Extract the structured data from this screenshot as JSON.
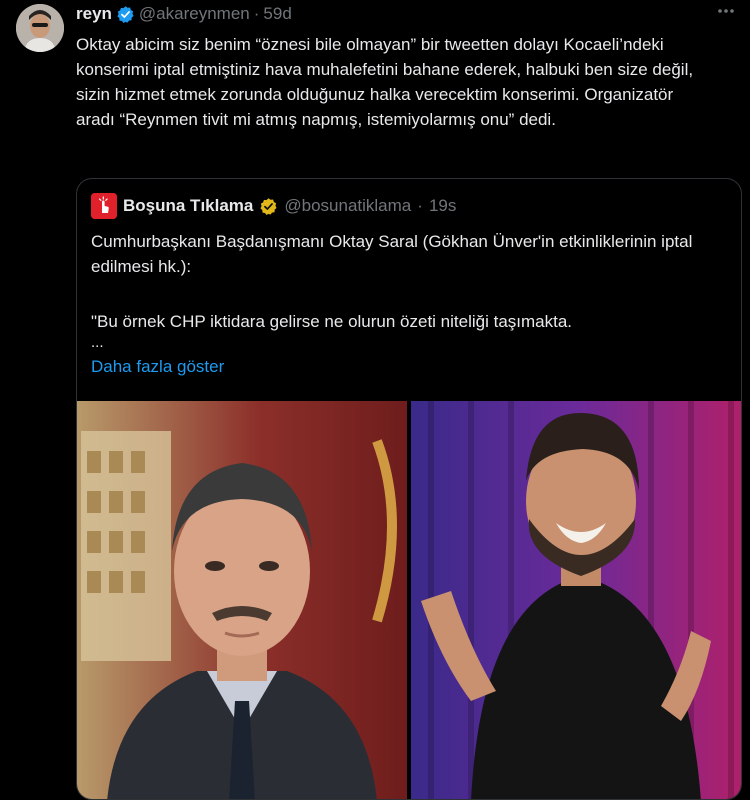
{
  "tweet": {
    "display_name": "reyn",
    "handle": "@akareynmen",
    "separator": "·",
    "time": "59d",
    "more_icon": "ellipsis-icon",
    "text": "Oktay abicim siz benim “öznesi bile olmayan” bir tweetten dolayı Kocaeli’ndeki konserimi iptal etmiştiniz hava muhalefetini bahane ederek, halbuki ben size değil, sizin hizmet etmek zorunda olduğunuz halka verecektim konserimi. Organizatör aradı “Reynmen tivit mi atmış napmış, istemiyolarmış onu” dedi."
  },
  "quoted": {
    "display_name": "Boşuna Tıklama",
    "handle": "@bosunatiklama",
    "separator": "·",
    "time": "19s",
    "paragraph1": "Cumhurbaşkanı Başdanışmanı Oktay Saral (Gökhan Ünver'in etkinliklerinin iptal edilmesi hk.):",
    "paragraph2": "\"Bu örnek CHP iktidara gelirse ne olurun özeti niteliği taşımakta.",
    "ellipsis": "...",
    "show_more": "Daha fazla göster"
  },
  "colors": {
    "background": "#000000",
    "text": "#e7e9ea",
    "muted": "#71767b",
    "link": "#1d9bf0",
    "verified_blue": "#1d9bf0",
    "verified_gold": "#e2b719",
    "border": "#2f3336"
  }
}
